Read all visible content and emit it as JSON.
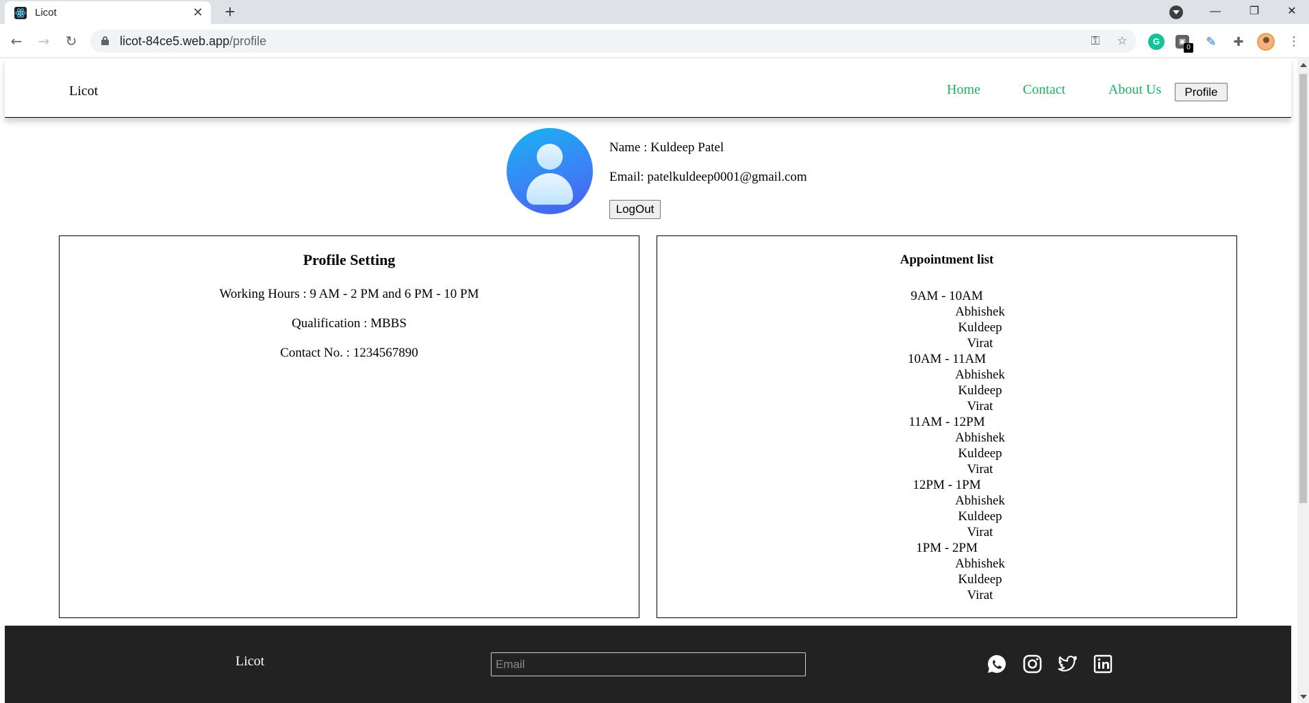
{
  "browser": {
    "tab_title": "Licot",
    "tab_close_glyph": "✕",
    "new_tab_glyph": "+",
    "url_host": "licot-84ce5.web.app",
    "url_path": "/profile",
    "window_minimize_glyph": "—",
    "window_restore_glyph": "❐",
    "window_close_glyph": "✕",
    "back_glyph": "←",
    "forward_glyph": "→",
    "reload_glyph": "↻",
    "key_glyph": "⚿",
    "star_glyph": "☆",
    "menu_glyph": "⋮",
    "extension_badge_count": "0"
  },
  "header": {
    "brand": "Licot",
    "nav": {
      "home": "Home",
      "contact": "Contact",
      "about": "About Us",
      "profile": "Profile"
    },
    "nav_color": "#17b35f"
  },
  "user": {
    "name_line": "Name : Kuldeep Patel",
    "email_line": "Email: patelkuldeep0001@gmail.com",
    "logout_label": "LogOut"
  },
  "profile_setting": {
    "title": "Profile Setting",
    "working_hours": "Working Hours : 9 AM - 2 PM and 6 PM - 10 PM",
    "qualification": "Qualification : MBBS",
    "contact": "Contact No. : 1234567890"
  },
  "appointments": {
    "title": "Appointment list",
    "slots": [
      {
        "time": "9AM - 10AM",
        "patients": [
          "Abhishek",
          "Kuldeep",
          "Virat"
        ]
      },
      {
        "time": "10AM - 11AM",
        "patients": [
          "Abhishek",
          "Kuldeep",
          "Virat"
        ]
      },
      {
        "time": "11AM - 12PM",
        "patients": [
          "Abhishek",
          "Kuldeep",
          "Virat"
        ]
      },
      {
        "time": "12PM - 1PM",
        "patients": [
          "Abhishek",
          "Kuldeep",
          "Virat"
        ]
      },
      {
        "time": "1PM - 2PM",
        "patients": [
          "Abhishek",
          "Kuldeep",
          "Virat"
        ]
      }
    ]
  },
  "footer": {
    "brand": "Licot",
    "email_placeholder": "Email",
    "social_icons": [
      "whatsapp-icon",
      "instagram-icon",
      "twitter-icon",
      "linkedin-icon"
    ],
    "background": "#222222"
  }
}
